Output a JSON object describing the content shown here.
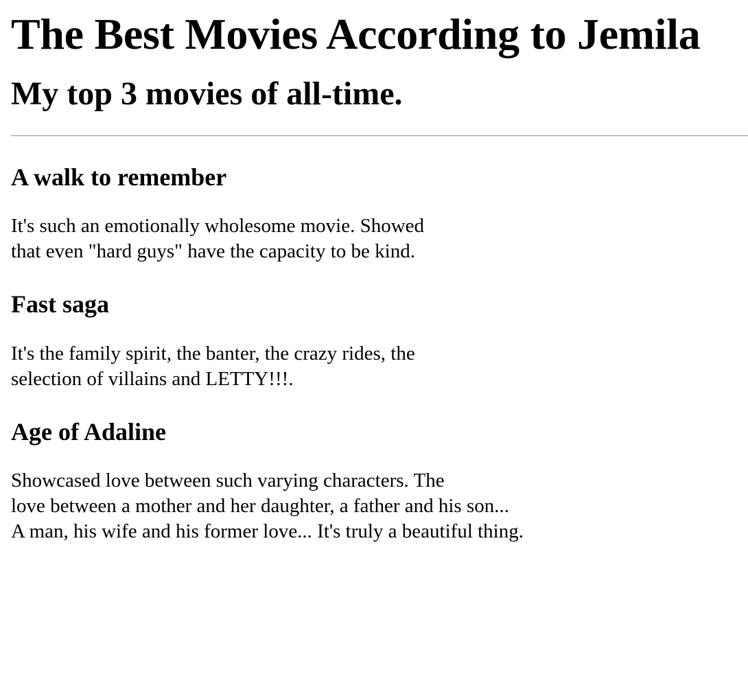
{
  "page": {
    "title": "The Best Movies According to Jemila",
    "subtitle": "My top 3 movies of all-time."
  },
  "movies": [
    {
      "title": "A walk to remember",
      "lines": [
        "It's such an emotionally wholesome movie. Showed",
        "that even \"hard guys\" have the capacity to be kind."
      ]
    },
    {
      "title": "Fast saga",
      "lines": [
        "It's the family spirit, the banter, the crazy rides, the",
        "selection of villains and LETTY!!!."
      ]
    },
    {
      "title": "Age of Adaline",
      "lines": [
        "Showcased love between such varying characters. The",
        "love between a mother and her daughter, a father and his son...",
        "A man, his wife and his former love... It's truly a beautiful thing."
      ]
    }
  ]
}
